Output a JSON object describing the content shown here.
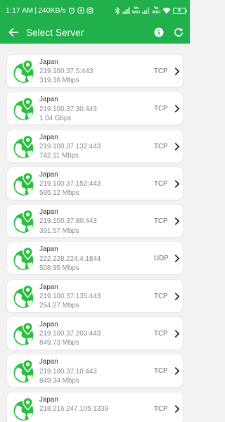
{
  "status_bar": {
    "time": "1:17 AM",
    "net_speed": "240KB/s",
    "battery": "9",
    "wifi_label_1": "Vo",
    "wifi_label_1b": "WiFi",
    "wifi_label_2": "Vo",
    "wifi_label_2b": "WiFi"
  },
  "app_bar": {
    "title": "Select Server"
  },
  "servers": [
    {
      "country": "Japan",
      "address": "219.100.37.5:443",
      "speed": "319.36 Mbps",
      "protocol": "TCP"
    },
    {
      "country": "Japan",
      "address": "219.100.37.30:443",
      "speed": "1.04 Gbps",
      "protocol": "TCP"
    },
    {
      "country": "Japan",
      "address": "219.100.37.132:443",
      "speed": "742.11 Mbps",
      "protocol": "TCP"
    },
    {
      "country": "Japan",
      "address": "219.100.37.152:443",
      "speed": "595.12 Mbps",
      "protocol": "TCP"
    },
    {
      "country": "Japan",
      "address": "219.100.37.80:443",
      "speed": "391.57 Mbps",
      "protocol": "TCP"
    },
    {
      "country": "Japan",
      "address": "222.228.224.4:1844",
      "speed": "508.95 Mbps",
      "protocol": "UDP"
    },
    {
      "country": "Japan",
      "address": "219.100.37.135:443",
      "speed": "254.27 Mbps",
      "protocol": "TCP"
    },
    {
      "country": "Japan",
      "address": "219.100.37.203:443",
      "speed": "849.73 Mbps",
      "protocol": "TCP"
    },
    {
      "country": "Japan",
      "address": "219.100.37.10:443",
      "speed": "849.34 Mbps",
      "protocol": "TCP"
    },
    {
      "country": "Japan",
      "address": "218.216.247.105:1339",
      "speed": "",
      "protocol": "TCP"
    }
  ],
  "colors": {
    "primary": "#21b14c",
    "card": "#ffffff",
    "background": "#f2f2f2"
  },
  "icons": {
    "back": "arrow-left-icon",
    "info": "info-icon",
    "refresh": "refresh-icon",
    "server": "globe-pin-icon",
    "chevron": "chevron-right-icon"
  }
}
